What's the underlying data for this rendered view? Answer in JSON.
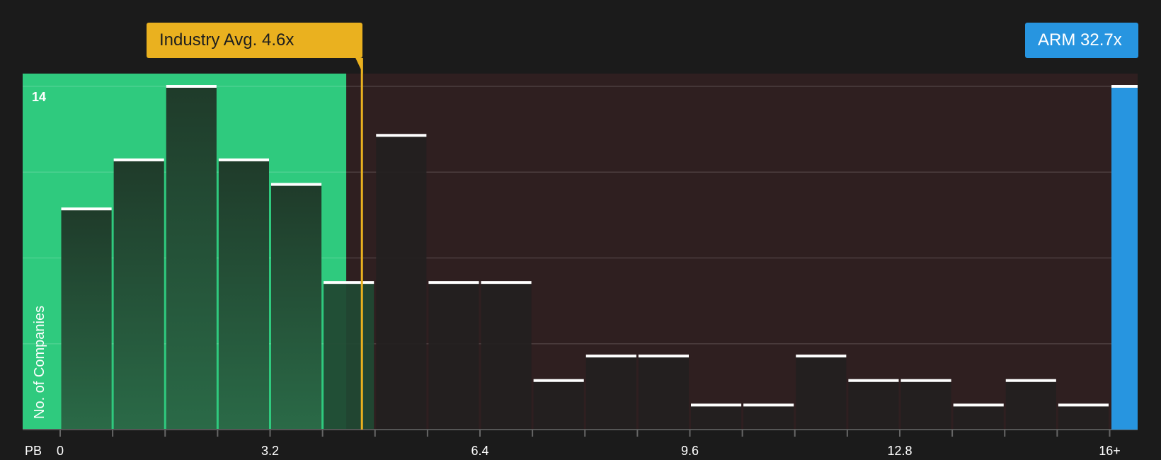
{
  "chart_data": {
    "type": "bar",
    "x_axis_label": "PB",
    "y_axis_label": "No. of Companies",
    "y_top_tick": "14",
    "ylim": [
      0,
      14.5
    ],
    "xlim": [
      0,
      16.4
    ],
    "x_ticks": [
      "0",
      "3.2",
      "6.4",
      "9.6",
      "12.8",
      "16+"
    ],
    "bin_width": 0.8,
    "bins_start": [
      0,
      0.8,
      1.6,
      2.4,
      3.2,
      4.0,
      4.8,
      5.6,
      6.4,
      7.2,
      8.0,
      8.8,
      9.6,
      10.4,
      11.2,
      12.0,
      12.8,
      13.6,
      14.4,
      15.2
    ],
    "values": [
      9,
      11,
      14,
      11,
      10,
      6,
      12,
      6,
      6,
      2,
      3,
      3,
      1,
      1,
      3,
      2,
      2,
      1,
      2,
      1
    ],
    "industry_average": {
      "label": "Industry Avg. 4.6x",
      "value": 4.6
    },
    "company": {
      "label": "ARM 32.7x",
      "ticker": "ARM",
      "value": 32.7,
      "count": 14
    },
    "colors": {
      "background": "#1b1b1b",
      "good_region": "#2fca7e",
      "bad_region": "#2f1f20",
      "bar_good": "#1f3f2c",
      "bar_bad": "#232020",
      "bar_cap": "#ffffff",
      "industry_line": "#eab11f",
      "company": "#2795e0"
    }
  }
}
